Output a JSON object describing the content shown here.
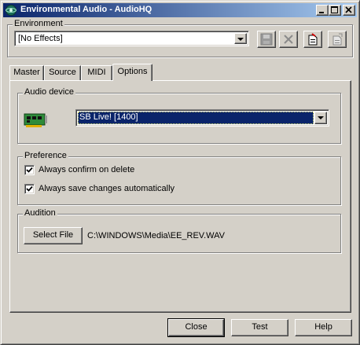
{
  "window": {
    "title": "Environmental Audio - AudioHQ"
  },
  "environment": {
    "group_label": "Environment",
    "selected": "[No Effects]"
  },
  "tabs": [
    {
      "label": "Master",
      "active": false
    },
    {
      "label": "Source",
      "active": false
    },
    {
      "label": "MIDI",
      "active": false
    },
    {
      "label": "Options",
      "active": true
    }
  ],
  "options": {
    "audio_device": {
      "group_label": "Audio device",
      "selected": "SB Live! [1400]"
    },
    "preference": {
      "group_label": "Preference",
      "items": [
        {
          "label": "Always confirm on delete",
          "checked": true
        },
        {
          "label": "Always save changes automatically",
          "checked": true
        }
      ]
    },
    "audition": {
      "group_label": "Audition",
      "button_label": "Select File",
      "file_path": "C:\\WINDOWS\\Media\\EE_REV.WAV"
    }
  },
  "footer": {
    "close_label": "Close",
    "test_label": "Test",
    "help_label": "Help"
  },
  "colors": {
    "titlebar_start": "#0a246a",
    "titlebar_end": "#a6caf0",
    "face": "#d4d0c8",
    "selection": "#0a246a"
  },
  "icons": {
    "app": "speaker-globe-icon",
    "save": "floppy-disk-icon",
    "delete": "x-icon",
    "new": "new-document-icon",
    "copy": "copy-document-icon",
    "device": "sound-card-icon"
  }
}
